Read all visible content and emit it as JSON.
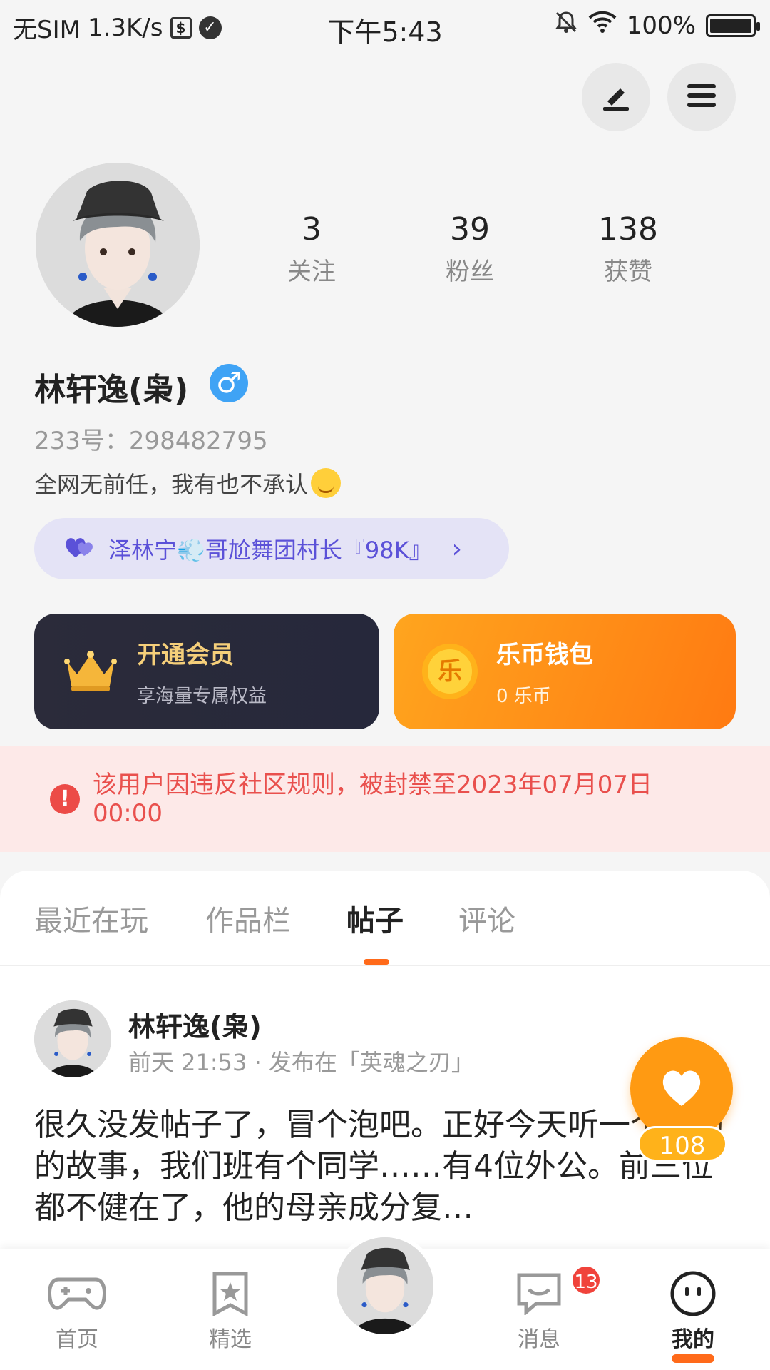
{
  "status_bar": {
    "carrier": "无SIM",
    "speed": "1.3K/s",
    "time": "下午5:43",
    "battery": "100%"
  },
  "header": {
    "edit_icon": "edit-icon",
    "menu_icon": "menu-icon"
  },
  "profile": {
    "stats": [
      {
        "value": "3",
        "label": "关注"
      },
      {
        "value": "39",
        "label": "粉丝"
      },
      {
        "value": "138",
        "label": "获赞"
      }
    ],
    "name": "林轩逸(枭)",
    "gender": "♂",
    "uid": "233号：298482795",
    "bio": "全网无前任，我有也不承认",
    "group": "泽林宁💨哥尬舞团村长『98K』"
  },
  "cards": {
    "vip": {
      "title": "开通会员",
      "subtitle": "享海量专属权益"
    },
    "wallet": {
      "title": "乐币钱包",
      "subtitle": "0 乐币",
      "coin_glyph": "乐"
    }
  },
  "ban_notice": "该用户因违反社区规则，被封禁至2023年07月07日 00:00",
  "tabs": [
    {
      "label": "最近在玩"
    },
    {
      "label": "作品栏"
    },
    {
      "label": "帖子"
    },
    {
      "label": "评论"
    }
  ],
  "active_tab": "帖子",
  "post": {
    "author": "林轩逸(枭)",
    "meta": "前天 21:53 · 发布在「英魂之刃」",
    "body": "很久没发帖子了，冒个泡吧。正好今天听一个悲伤的故事，我们班有个同学……有4位外公。前三位都不健在了，他的母亲成分复…",
    "likes": "108"
  },
  "bottom_nav": {
    "items": [
      {
        "label": "首页",
        "icon": "gamepad-icon"
      },
      {
        "label": "精选",
        "icon": "star-bookmark-icon"
      },
      {
        "label": "消息",
        "icon": "chat-icon",
        "badge": "13"
      },
      {
        "label": "我的",
        "icon": "face-icon"
      }
    ]
  },
  "colors": {
    "accent": "#ff6a1a",
    "ban_text": "#e9504d",
    "group_text": "#5b51d8",
    "vip_title": "#f5cf7a"
  }
}
